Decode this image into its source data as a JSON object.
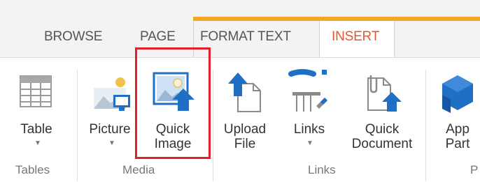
{
  "tabs": [
    {
      "label": "BROWSE"
    },
    {
      "label": "PAGE"
    },
    {
      "label": "FORMAT TEXT"
    },
    {
      "label": "INSERT"
    }
  ],
  "ribbon": {
    "table_label": "Table",
    "picture_label": "Picture",
    "quick_image_label_line1": "Quick",
    "quick_image_label_line2": "Image",
    "upload_file_label_line1": "Upload",
    "upload_file_label_line2": "File",
    "links_label": "Links",
    "quick_document_label_line1": "Quick",
    "quick_document_label_line2": "Document",
    "app_part_label_line1": "App",
    "app_part_label_line2": "Part"
  },
  "groups": {
    "tables": "Tables",
    "media": "Media",
    "links": "Links",
    "parts": "P"
  },
  "icons": {
    "table": "table-grid-icon",
    "picture": "picture-icon",
    "quick_image": "quick-image-icon",
    "upload_file": "upload-file-icon",
    "links": "links-icon",
    "quick_document": "quick-document-icon",
    "app_part": "app-part-icon"
  },
  "colors": {
    "accent": "#f5a623",
    "active_tab": "#e4572e",
    "highlight": "#e0202a",
    "icon_blue": "#1f6fc5"
  }
}
